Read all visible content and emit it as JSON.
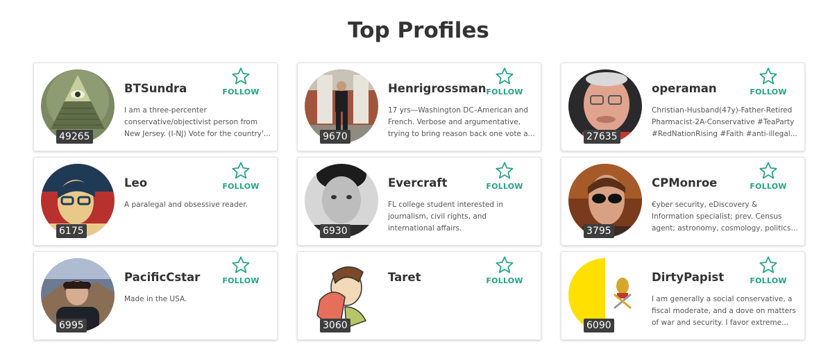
{
  "page": {
    "title": "Top Profiles"
  },
  "follow_label": "FOLLOW",
  "colors": {
    "accent": "#24a386",
    "badge_bg": "#3d3d3d"
  },
  "profiles": [
    {
      "name": "BTSundra",
      "score": "49265",
      "bio": "I am a three-percenter conservative/objectivist person from New Jersey. (I-NJ) Vote for the country'...",
      "avatar": "eye-of-providence-image"
    },
    {
      "name": "Henrigrossman",
      "score": "9670",
      "bio": "17 yrs—Washington DC–American and French. Verbose and argumentative, trying to bring reason back one vote a...",
      "avatar": "man-in-suit-photo"
    },
    {
      "name": "operaman",
      "score": "27635",
      "bio": "Christian-Husband(47y)-Father-Retired Pharmacist-2A-Conservative #TeaParty #RedNationRising #Faith #anti-illegal...",
      "avatar": "older-man-glasses-photo"
    },
    {
      "name": "Leo",
      "score": "6175",
      "bio": "A paralegal and obsessive reader.",
      "avatar": "red-poster-portrait"
    },
    {
      "name": "Evercraft",
      "score": "6930",
      "bio": "FL college student interested in journalism, civil rights, and international affairs.",
      "avatar": "grayscale-portrait"
    },
    {
      "name": "CPMonroe",
      "score": "3795",
      "bio": "€yber security, eDiscovery & Information specialist; prev. Census agent; astronomy, cosmology, politics ...",
      "avatar": "sunglasses-man-photo"
    },
    {
      "name": "PacificCstar",
      "score": "6995",
      "bio": "Made in the USA.",
      "avatar": "woman-landscape-photo"
    },
    {
      "name": "Taret",
      "score": "3060",
      "bio": "",
      "avatar": "cartoon-towel-drawing"
    },
    {
      "name": "DirtyPapist",
      "score": "6090",
      "bio": "I am generally a social conservative, a fiscal moderate, and a dove on matters of war and security. I favor extreme...",
      "avatar": "vatican-flag"
    }
  ]
}
